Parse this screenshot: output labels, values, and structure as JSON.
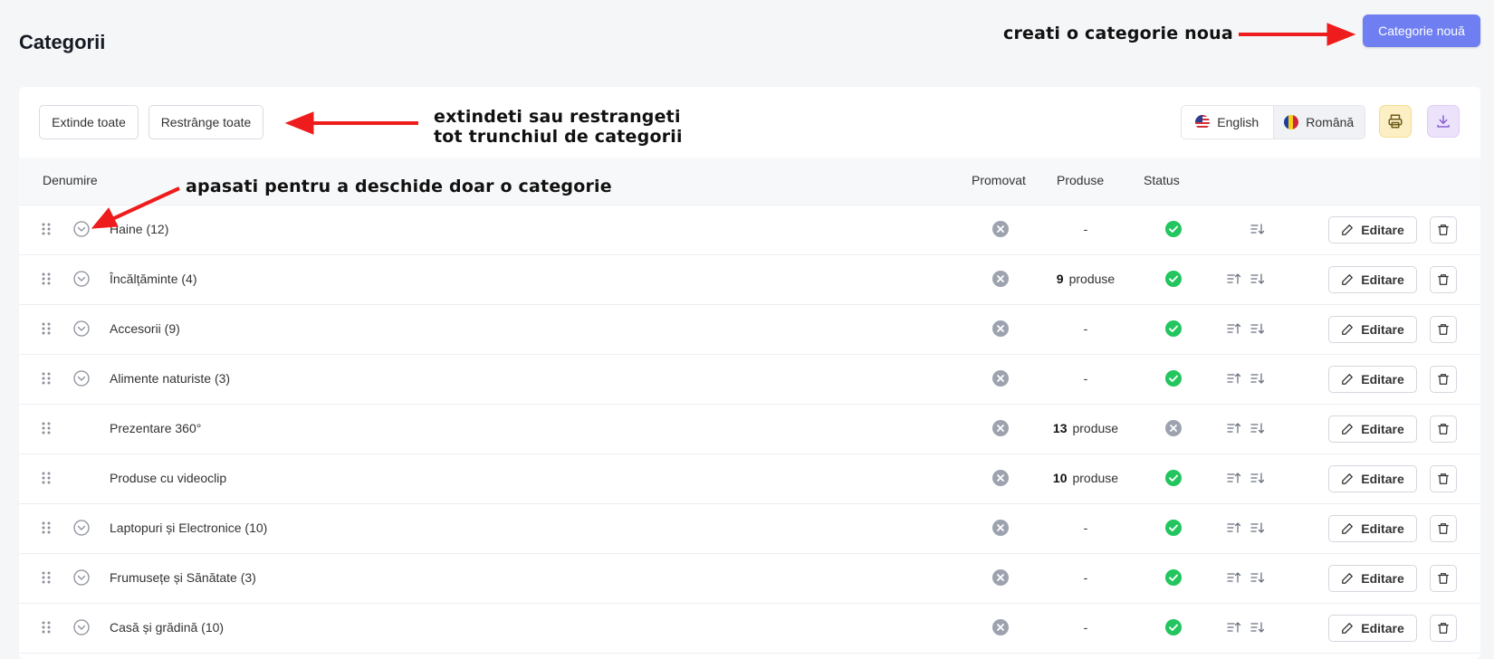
{
  "page": {
    "title": "Categorii"
  },
  "header": {
    "new_category_label": "Categorie nouă"
  },
  "annotations": {
    "new_category": "creati o categorie noua",
    "expand_collapse_line1": "extindeti sau restrangeti",
    "expand_collapse_line2": "tot trunchiul de categorii",
    "open_one": "apasati pentru a deschide doar o categorie"
  },
  "toolbar": {
    "expand_all_label": "Extinde toate",
    "collapse_all_label": "Restrânge toate",
    "languages": [
      {
        "label": "English",
        "flag": "us-flag-icon",
        "active": false
      },
      {
        "label": "Română",
        "flag": "ro-flag-icon",
        "active": true
      }
    ],
    "print_icon": "printer-icon",
    "download_icon": "download-icon"
  },
  "table": {
    "columns": {
      "name": "Denumire",
      "promoted": "Promovat",
      "products": "Produse",
      "status": "Status"
    },
    "edit_label": "Editare",
    "products_suffix": "produse",
    "rows": [
      {
        "name": "Haine (12)",
        "has_children": true,
        "promoted": false,
        "products_count": "",
        "products_text": "-",
        "status_active": true,
        "sort_up": false,
        "sort_down": true
      },
      {
        "name": "Încălțăminte (4)",
        "has_children": true,
        "promoted": false,
        "products_count": "9",
        "products_text": "produse",
        "status_active": true,
        "sort_up": true,
        "sort_down": true
      },
      {
        "name": "Accesorii (9)",
        "has_children": true,
        "promoted": false,
        "products_count": "",
        "products_text": "-",
        "status_active": true,
        "sort_up": true,
        "sort_down": true
      },
      {
        "name": "Alimente naturiste (3)",
        "has_children": true,
        "promoted": false,
        "products_count": "",
        "products_text": "-",
        "status_active": true,
        "sort_up": true,
        "sort_down": true
      },
      {
        "name": "Prezentare 360°",
        "has_children": false,
        "promoted": false,
        "products_count": "13",
        "products_text": "produse",
        "status_active": false,
        "sort_up": true,
        "sort_down": true
      },
      {
        "name": "Produse cu videoclip",
        "has_children": false,
        "promoted": false,
        "products_count": "10",
        "products_text": "produse",
        "status_active": true,
        "sort_up": true,
        "sort_down": true
      },
      {
        "name": "Laptopuri și Electronice (10)",
        "has_children": true,
        "promoted": false,
        "products_count": "",
        "products_text": "-",
        "status_active": true,
        "sort_up": true,
        "sort_down": true
      },
      {
        "name": "Frumusețe și Sănătate (3)",
        "has_children": true,
        "promoted": false,
        "products_count": "",
        "products_text": "-",
        "status_active": true,
        "sort_up": true,
        "sort_down": true
      },
      {
        "name": "Casă și grădină (10)",
        "has_children": true,
        "promoted": false,
        "products_count": "",
        "products_text": "-",
        "status_active": true,
        "sort_up": true,
        "sort_down": true
      }
    ]
  },
  "colors": {
    "accent": "#6f7ff2",
    "status_active": "#22c55e",
    "status_inactive": "#9ca3af",
    "annotation_arrow": "#ee1c1c",
    "print_bg": "#fcefc4",
    "download_bg": "#ece3fb"
  }
}
